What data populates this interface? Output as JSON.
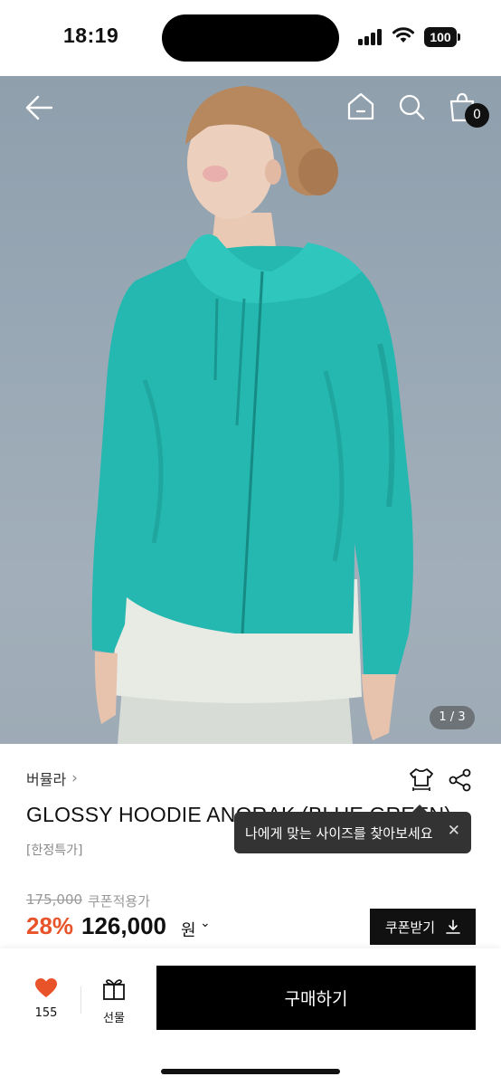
{
  "status_bar": {
    "time": "18:19",
    "battery": "100"
  },
  "gallery": {
    "page_indicator": "1 / 3",
    "cart_count": "0"
  },
  "product": {
    "brand": "버뮬라",
    "brand_chevron": "›",
    "title": "GLOSSY HOODIE ANORAK (BLUE GREEN)",
    "tag": "[한정특가]",
    "original_price": "175,000",
    "coupon_price_label": "쿠폰적용가",
    "discount": "28%",
    "price": "126,000",
    "currency": "원",
    "price_chevron": "⌄"
  },
  "tooltip": {
    "text": "나에게 맞는 사이즈를 찾아보세요",
    "close": "✕"
  },
  "coupon_button": {
    "label": "쿠폰받기"
  },
  "bottom_bar": {
    "like_count": "155",
    "gift_label": "선물",
    "buy_label": "구매하기"
  },
  "colors": {
    "accent_discount": "#e8532a",
    "jacket": "#25b8b0",
    "heart": "#e8532a"
  },
  "icons": [
    "back-arrow-icon",
    "home-icon",
    "search-icon",
    "shopping-bag-icon",
    "size-fit-icon",
    "share-icon",
    "heart-icon",
    "gift-icon",
    "download-icon",
    "close-icon"
  ]
}
